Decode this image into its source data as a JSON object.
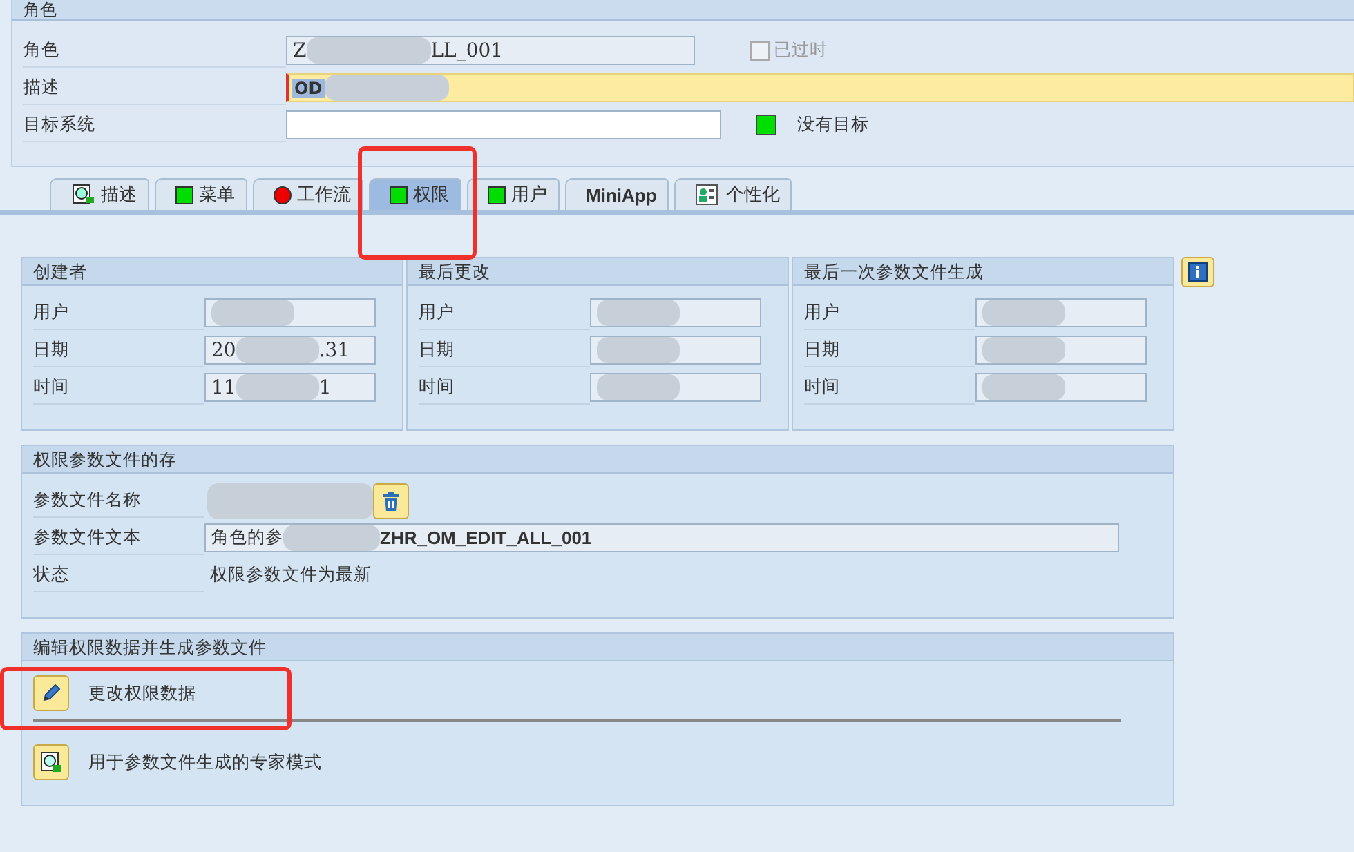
{
  "role_section": {
    "title": "角色",
    "role": {
      "label": "角色",
      "value_start": "Z",
      "value_end": "LL_001"
    },
    "obsolete": {
      "label": "已过时",
      "checked": false,
      "disabled": true
    },
    "description": {
      "label": "描述",
      "value_start": "OD"
    },
    "target_system": {
      "label": "目标系统",
      "status_ok": true,
      "status_text": "没有目标"
    }
  },
  "tabs": [
    {
      "label": "描述",
      "kind": "icon",
      "selected": false
    },
    {
      "label": "菜单",
      "kind": "status",
      "color": "#00dd00",
      "selected": false
    },
    {
      "label": "工作流",
      "kind": "status",
      "color": "#ee0000",
      "selected": false
    },
    {
      "label": "权限",
      "kind": "status",
      "color": "#00dd00",
      "selected": true
    },
    {
      "label": "用户",
      "kind": "status",
      "color": "#00dd00",
      "selected": false
    },
    {
      "label": "MiniApp",
      "kind": "plain",
      "selected": false
    },
    {
      "label": "个性化",
      "kind": "person",
      "selected": false
    }
  ],
  "info_groups": [
    {
      "title": "创建者",
      "rows": [
        {
          "label": "用户"
        },
        {
          "label": "日期",
          "value_start": "20",
          "value_end": ".31"
        },
        {
          "label": "时间",
          "value_start": "11",
          "value_end": "1"
        }
      ]
    },
    {
      "title": "最后更改",
      "rows": [
        {
          "label": "用户"
        },
        {
          "label": "日期"
        },
        {
          "label": "时间"
        }
      ]
    },
    {
      "title": "最后一次参数文件生成",
      "rows": [
        {
          "label": "用户"
        },
        {
          "label": "日期"
        },
        {
          "label": "时间"
        }
      ]
    }
  ],
  "profile_group": {
    "title": "权限参数文件的存",
    "name_label": "参数文件名称",
    "text_label": "参数文件文本",
    "text_start": "角色的参",
    "text_end": "ZHR_OM_EDIT_ALL_001",
    "status_label": "状态",
    "status_value": "权限参数文件为最新"
  },
  "edit_group": {
    "title": "编辑权限数据并生成参数文件",
    "actions": [
      {
        "kind": "edit",
        "label": "更改权限数据"
      },
      {
        "kind": "expert",
        "label": "用于参数文件生成的专家模式"
      }
    ]
  }
}
